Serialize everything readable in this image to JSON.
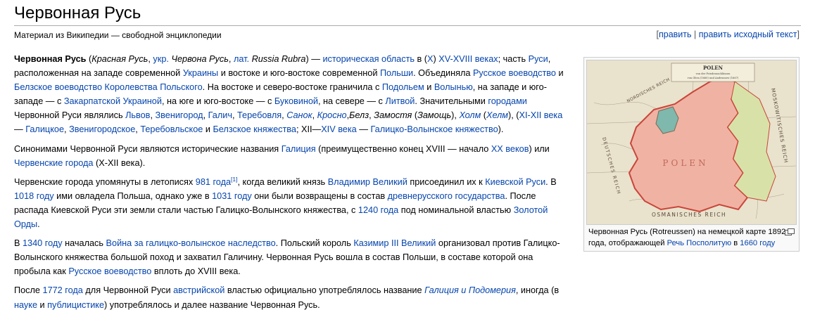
{
  "page": {
    "title": "Червонная Русь",
    "site_sub": "Материал из Википедии — свободной энциклопедии",
    "edit": {
      "open_bracket": "[",
      "edit_label": "править",
      "separator": " | ",
      "edit_source_label": "править исходный текст",
      "close_bracket": "]"
    }
  },
  "article": {
    "paragraphs": [
      [
        {
          "text": "Червонная Русь",
          "style": "b"
        },
        {
          "text": " ("
        },
        {
          "text": "Красная Русь",
          "style": "i"
        },
        {
          "text": ", "
        },
        {
          "text": "укр.",
          "link": true
        },
        {
          "text": " "
        },
        {
          "text": "Червона Русь",
          "style": "i"
        },
        {
          "text": ", "
        },
        {
          "text": "лат.",
          "link": true
        },
        {
          "text": " "
        },
        {
          "text": "Russia Rubra",
          "style": "i"
        },
        {
          "text": ") — "
        },
        {
          "text": "историческая область",
          "link": true
        },
        {
          "text": " в ("
        },
        {
          "text": "X",
          "link": true
        },
        {
          "text": ") "
        },
        {
          "text": "XV-XVIII веках",
          "link": true
        },
        {
          "text": "; часть "
        },
        {
          "text": "Руси",
          "link": true
        },
        {
          "text": ", расположенная на западе современной "
        },
        {
          "text": "Украины",
          "link": true
        },
        {
          "text": " и востоке и юго-востоке современной "
        },
        {
          "text": "Польши",
          "link": true
        },
        {
          "text": ". Объединяла "
        },
        {
          "text": "Русское воеводство",
          "link": true
        },
        {
          "text": " и "
        },
        {
          "text": "Белзское воеводство",
          "link": true
        },
        {
          "text": " "
        },
        {
          "text": "Королевства Польского",
          "link": true
        },
        {
          "text": ". На востоке и северо-востоке граничила с "
        },
        {
          "text": "Подольем",
          "link": true
        },
        {
          "text": " и "
        },
        {
          "text": "Волынью",
          "link": true
        },
        {
          "text": ", на западе и юго-западе — с "
        },
        {
          "text": "Закарпатской Украиной",
          "link": true
        },
        {
          "text": ", на юге и юго-востоке — с "
        },
        {
          "text": "Буковиной",
          "link": true
        },
        {
          "text": ", на севере — с "
        },
        {
          "text": "Литвой",
          "link": true
        },
        {
          "text": ". Значительными "
        },
        {
          "text": "городами",
          "link": true
        },
        {
          "text": " Червонной Руси являлись "
        },
        {
          "text": "Львов",
          "link": true
        },
        {
          "text": ", "
        },
        {
          "text": "Звенигород",
          "link": true
        },
        {
          "text": ", "
        },
        {
          "text": "Галич",
          "link": true
        },
        {
          "text": ", "
        },
        {
          "text": "Теребовля",
          "link": true
        },
        {
          "text": ", "
        },
        {
          "text": "Санок",
          "link": true,
          "style": "i"
        },
        {
          "text": ", "
        },
        {
          "text": "Кросно",
          "link": true,
          "style": "i"
        },
        {
          "text": ","
        },
        {
          "text": "Белз",
          "style": "i"
        },
        {
          "text": ", "
        },
        {
          "text": "Замостя",
          "style": "i"
        },
        {
          "text": " ("
        },
        {
          "text": "Замощь",
          "style": "i"
        },
        {
          "text": "), "
        },
        {
          "text": "Холм",
          "link": true,
          "style": "i"
        },
        {
          "text": " ("
        },
        {
          "text": "Хелм",
          "link": true,
          "style": "i"
        },
        {
          "text": "), ("
        },
        {
          "text": "XI-XII века",
          "link": true
        },
        {
          "text": " — "
        },
        {
          "text": "Галицкое",
          "link": true
        },
        {
          "text": ", "
        },
        {
          "text": "Звенигородское",
          "link": true
        },
        {
          "text": ", "
        },
        {
          "text": "Теребовльское",
          "link": true
        },
        {
          "text": " и "
        },
        {
          "text": "Белзское княжества",
          "link": true
        },
        {
          "text": "; XII—"
        },
        {
          "text": "XIV века",
          "link": true
        },
        {
          "text": " — "
        },
        {
          "text": "Галицко-Волынское княжество",
          "link": true
        },
        {
          "text": ")."
        }
      ],
      [
        {
          "text": "Синонимами Червонной Руси являются исторические названия "
        },
        {
          "text": "Галиция",
          "link": true
        },
        {
          "text": " (преимущественно конец XVIII — начало "
        },
        {
          "text": "XX веков",
          "link": true
        },
        {
          "text": ") или "
        },
        {
          "text": "Червенские города",
          "link": true
        },
        {
          "text": " (X-XII века)."
        }
      ],
      [
        {
          "text": "Червенские города упомянуты в летописях "
        },
        {
          "text": "981 года",
          "link": true
        },
        {
          "text": "[1]",
          "link": true,
          "style": "sup"
        },
        {
          "text": ", когда великий князь "
        },
        {
          "text": "Владимир Великий",
          "link": true
        },
        {
          "text": " присоединил их к "
        },
        {
          "text": "Киевской Руси",
          "link": true
        },
        {
          "text": ". В "
        },
        {
          "text": "1018 году",
          "link": true
        },
        {
          "text": " ими овладела Польша, однако уже в "
        },
        {
          "text": "1031 году",
          "link": true
        },
        {
          "text": " они были возвращены в состав "
        },
        {
          "text": "древнерусского государства",
          "link": true
        },
        {
          "text": ". После распада Киевской Руси эти земли стали частью Галицко-Волынского княжества, с "
        },
        {
          "text": "1240 года",
          "link": true
        },
        {
          "text": " под номинальной властью "
        },
        {
          "text": "Золотой Орды",
          "link": true
        },
        {
          "text": "."
        }
      ],
      [
        {
          "text": "В "
        },
        {
          "text": "1340 году",
          "link": true
        },
        {
          "text": " началась "
        },
        {
          "text": "Война за галицко-волынское наследство",
          "link": true
        },
        {
          "text": ". Польский король "
        },
        {
          "text": "Казимир III Великий",
          "link": true
        },
        {
          "text": " организовал против Галицко-Волынского княжества большой поход и захватил Галичину. Червонная Русь вошла в состав Польши, в составе которой она пробыла как "
        },
        {
          "text": "Русское воеводство",
          "link": true
        },
        {
          "text": " вплоть до XVIII века."
        }
      ],
      [
        {
          "text": "После "
        },
        {
          "text": "1772 года",
          "link": true
        },
        {
          "text": " для Червонной Руси "
        },
        {
          "text": "австрийской",
          "link": true
        },
        {
          "text": " властью официально употреблялось название "
        },
        {
          "text": "Галиция и Подомерия",
          "link": true,
          "style": "i"
        },
        {
          "text": ", иногда (в "
        },
        {
          "text": "науке",
          "link": true
        },
        {
          "text": " и "
        },
        {
          "text": "публицистике",
          "link": true
        },
        {
          "text": ") употреблялось и далее название Червонная Русь."
        }
      ]
    ]
  },
  "figure": {
    "map": {
      "title": "POLEN",
      "subtitle_1": "von der Friedensschlüssen",
      "subtitle_2": "von Oliva (1660) und Andrussow (1667)",
      "north_label": "NORDISCHES REICH",
      "east_label": "MOSKOWITISCHES REICH",
      "west_label": "DEUTSCHES REICH",
      "south_label": "OSMANISCHES REICH",
      "center_label": "POLEN",
      "colors": {
        "paper": "#e9e2cd",
        "poland": "#f0b2a3",
        "poland_border": "#c9453a",
        "green": "#d8e2a8",
        "teal": "#7fb8ac",
        "lines": "#7a6a55"
      }
    },
    "caption": [
      {
        "text": "Червонная Русь (Rotreussen) на немецкой карте 1892 года, отображающей "
      },
      {
        "text": "Речь Посполитую",
        "link": true
      },
      {
        "text": " в "
      },
      {
        "text": "1660 году",
        "link": true
      }
    ],
    "magnify_icon": "magnify-icon"
  }
}
